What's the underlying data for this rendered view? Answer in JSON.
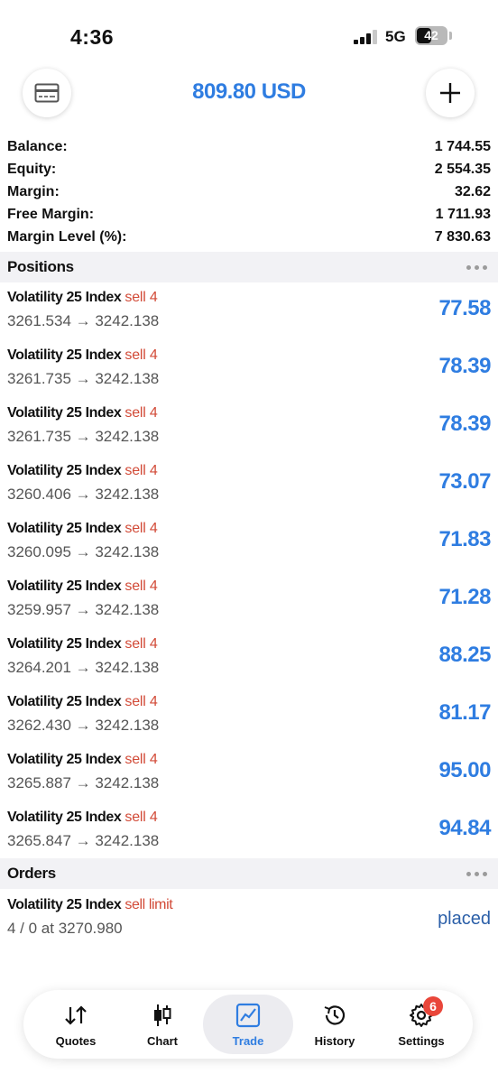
{
  "status_bar": {
    "time": "4:36",
    "network": "5G",
    "battery": "42"
  },
  "header": {
    "title": "809.80 USD"
  },
  "summary": [
    {
      "label": "Balance:",
      "value": "1 744.55"
    },
    {
      "label": "Equity:",
      "value": "2 554.35"
    },
    {
      "label": "Margin:",
      "value": "32.62"
    },
    {
      "label": "Free Margin:",
      "value": "1 711.93"
    },
    {
      "label": "Margin Level (%):",
      "value": "7 830.63"
    }
  ],
  "positions_section": {
    "title": "Positions"
  },
  "positions": [
    {
      "symbol": "Volatility 25 Index",
      "side": "sell 4",
      "prices": "3261.534 → 3242.138",
      "profit": "77.58"
    },
    {
      "symbol": "Volatility 25 Index",
      "side": "sell 4",
      "prices": "3261.735 → 3242.138",
      "profit": "78.39"
    },
    {
      "symbol": "Volatility 25 Index",
      "side": "sell 4",
      "prices": "3261.735 → 3242.138",
      "profit": "78.39"
    },
    {
      "symbol": "Volatility 25 Index",
      "side": "sell 4",
      "prices": "3260.406 → 3242.138",
      "profit": "73.07"
    },
    {
      "symbol": "Volatility 25 Index",
      "side": "sell 4",
      "prices": "3260.095 → 3242.138",
      "profit": "71.83"
    },
    {
      "symbol": "Volatility 25 Index",
      "side": "sell 4",
      "prices": "3259.957 → 3242.138",
      "profit": "71.28"
    },
    {
      "symbol": "Volatility 25 Index",
      "side": "sell 4",
      "prices": "3264.201 → 3242.138",
      "profit": "88.25"
    },
    {
      "symbol": "Volatility 25 Index",
      "side": "sell 4",
      "prices": "3262.430 → 3242.138",
      "profit": "81.17"
    },
    {
      "symbol": "Volatility 25 Index",
      "side": "sell 4",
      "prices": "3265.887 → 3242.138",
      "profit": "95.00"
    },
    {
      "symbol": "Volatility 25 Index",
      "side": "sell 4",
      "prices": "3265.847 → 3242.138",
      "profit": "94.84"
    }
  ],
  "orders_section": {
    "title": "Orders"
  },
  "orders": [
    {
      "symbol": "Volatility 25 Index",
      "side": "sell limit",
      "detail": "4 / 0 at 3270.980",
      "status": "placed"
    }
  ],
  "tabs": [
    {
      "label": "Quotes",
      "icon": "quotes-arrows-icon"
    },
    {
      "label": "Chart",
      "icon": "candlestick-icon"
    },
    {
      "label": "Trade",
      "icon": "trade-chart-icon",
      "active": true
    },
    {
      "label": "History",
      "icon": "history-clock-icon"
    },
    {
      "label": "Settings",
      "icon": "gear-icon",
      "badge": "6"
    }
  ],
  "colors": {
    "accent": "#2f7de1",
    "sell": "#d24a37",
    "badge": "#e9463a"
  }
}
